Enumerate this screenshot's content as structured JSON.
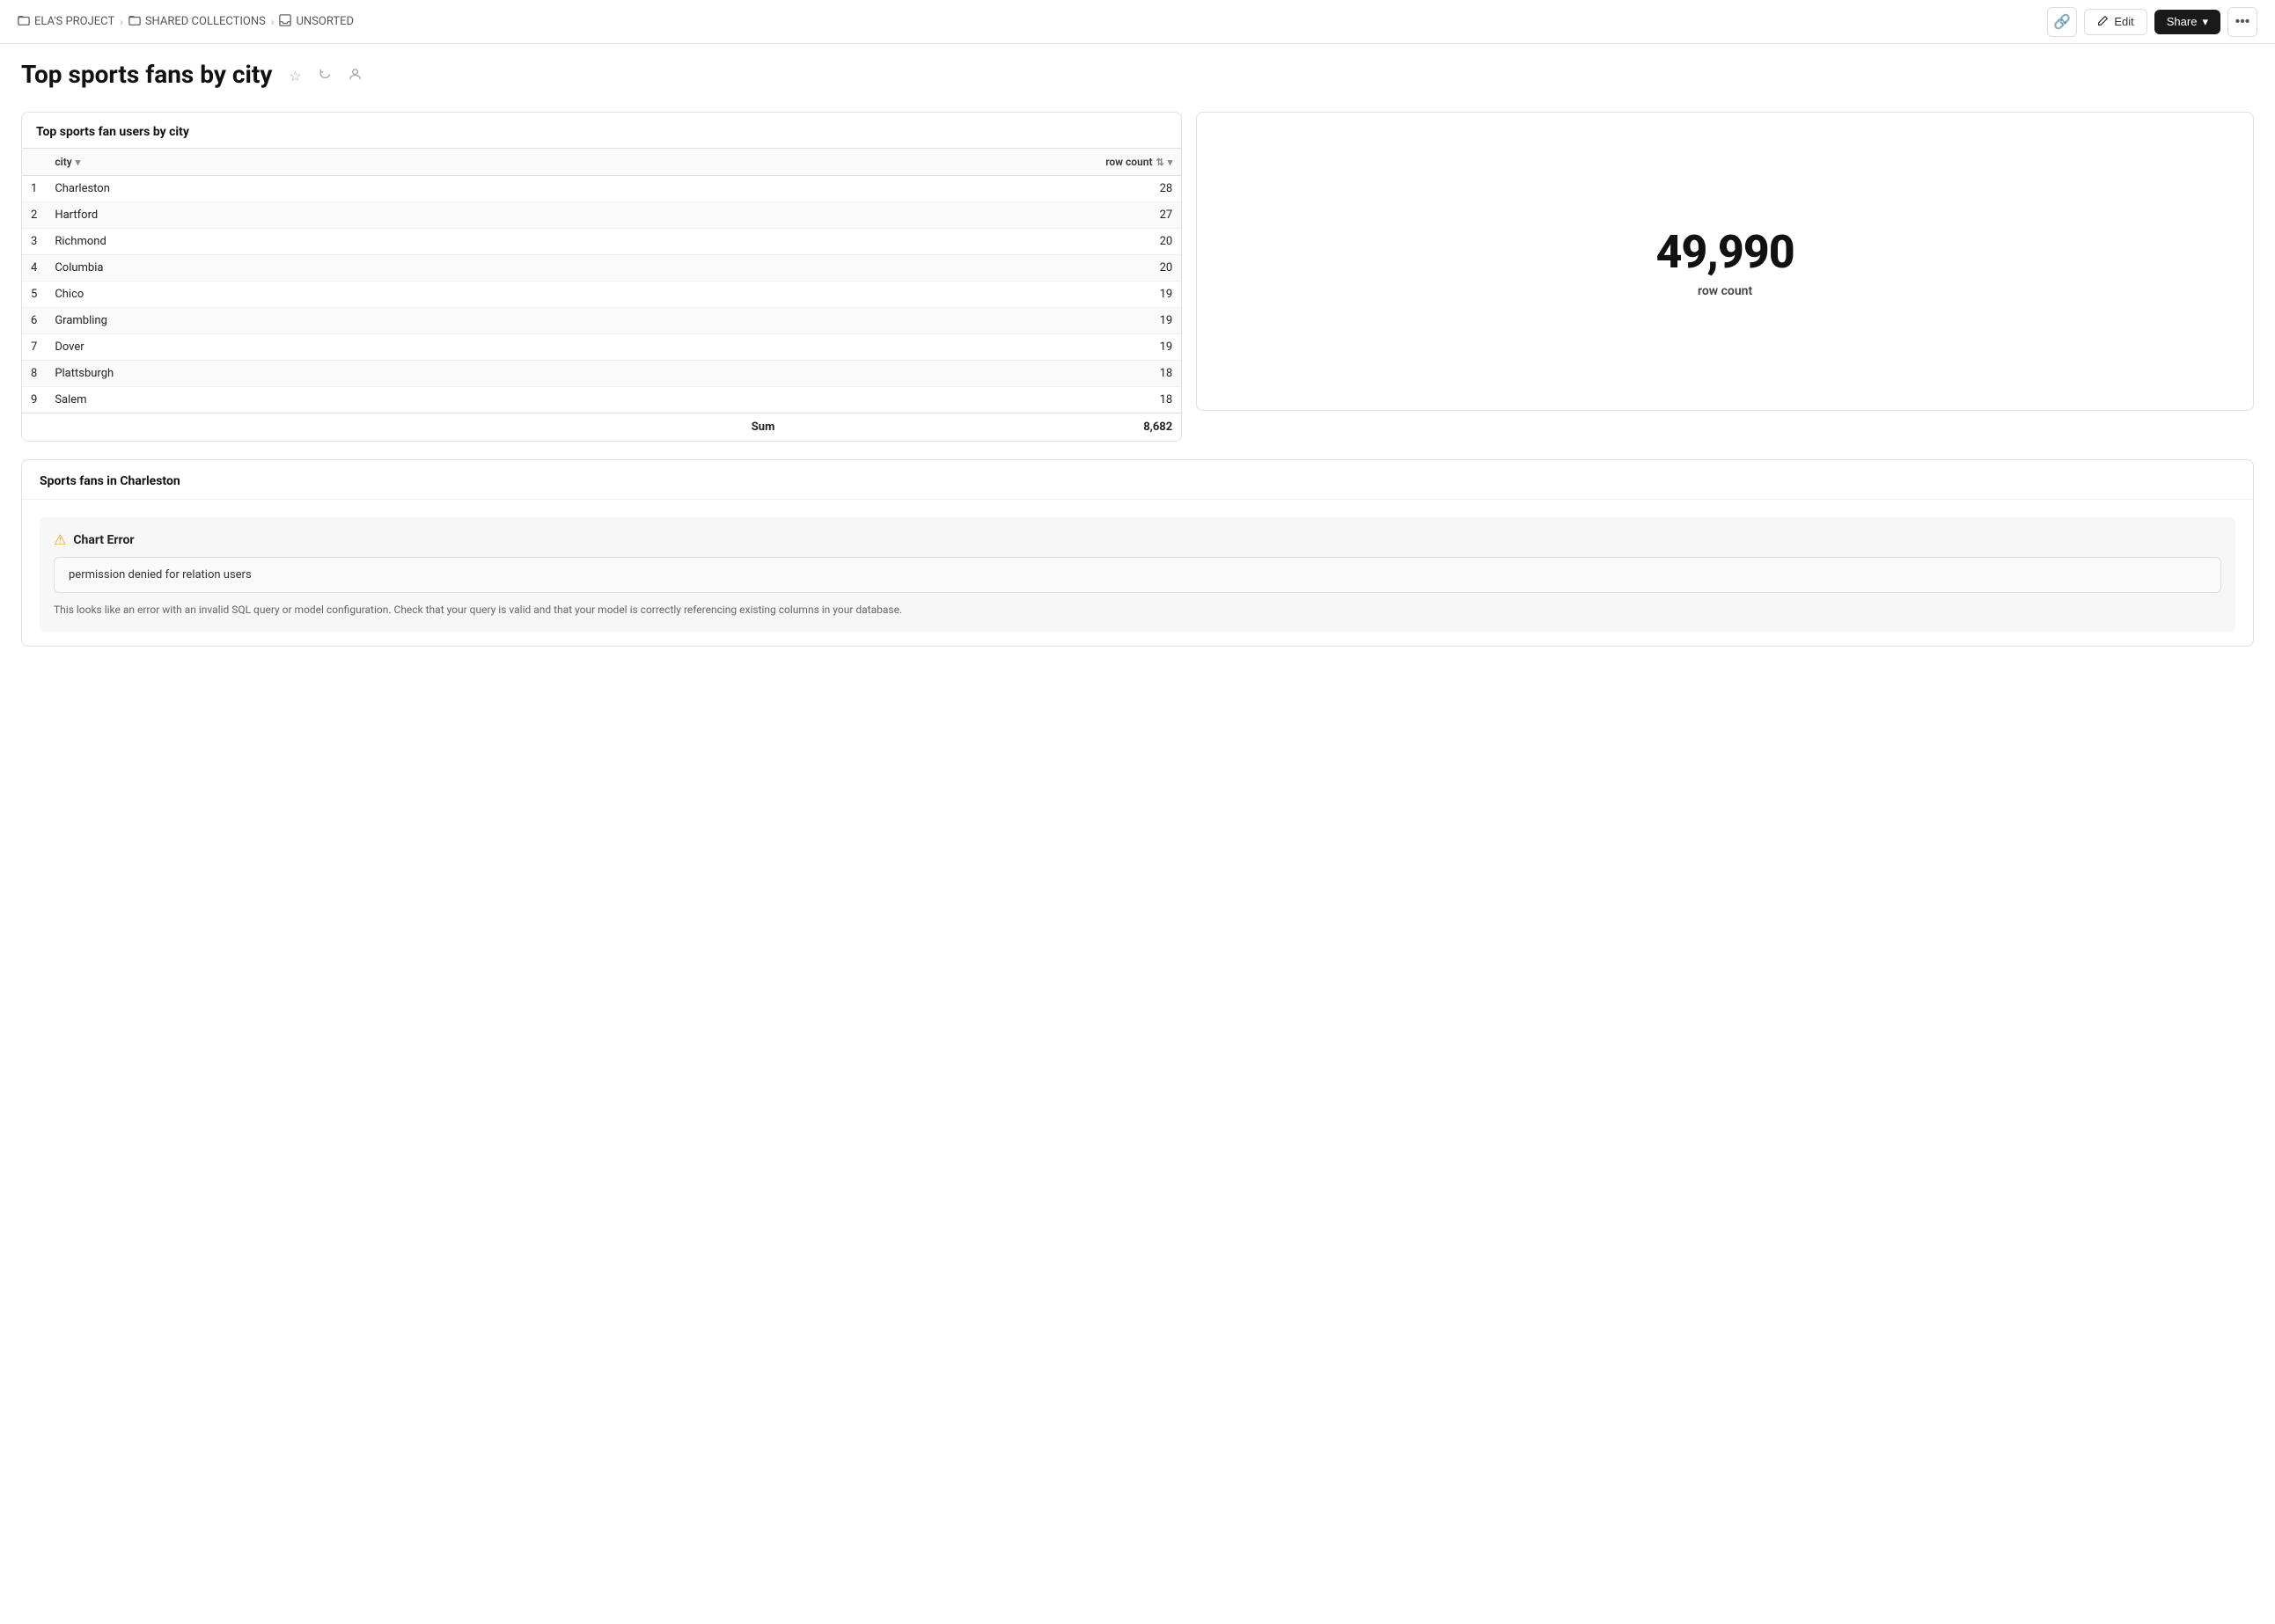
{
  "breadcrumb": {
    "items": [
      {
        "label": "ELA'S PROJECT",
        "icon": "folder-icon"
      },
      {
        "label": "SHARED COLLECTIONS",
        "icon": "folder-icon"
      },
      {
        "label": "UNSORTED",
        "icon": "inbox-icon"
      }
    ]
  },
  "nav": {
    "link_icon": "🔗",
    "edit_label": "Edit",
    "share_label": "Share",
    "more_icon": "⋯"
  },
  "page": {
    "title": "Top sports fans by city"
  },
  "table_card": {
    "title": "Top sports fan users by city",
    "columns": {
      "city": "city",
      "row_count": "row count"
    },
    "rows": [
      {
        "num": 1,
        "city": "Charleston",
        "count": 28
      },
      {
        "num": 2,
        "city": "Hartford",
        "count": 27
      },
      {
        "num": 3,
        "city": "Richmond",
        "count": 20
      },
      {
        "num": 4,
        "city": "Columbia",
        "count": 20
      },
      {
        "num": 5,
        "city": "Chico",
        "count": 19
      },
      {
        "num": 6,
        "city": "Grambling",
        "count": 19
      },
      {
        "num": 7,
        "city": "Dover",
        "count": 19
      },
      {
        "num": 8,
        "city": "Plattsburgh",
        "count": 18
      },
      {
        "num": 9,
        "city": "Salem",
        "count": 18
      }
    ],
    "footer": {
      "label": "Sum",
      "value": "8,682"
    }
  },
  "metric_card": {
    "value": "49,990",
    "label": "row count"
  },
  "charleston_card": {
    "title": "Sports fans in Charleston",
    "error_title": "Chart Error",
    "error_message": "permission denied for relation users",
    "error_hint": "This looks like an error with an invalid SQL query or model configuration. Check that your query is valid and that your model is correctly referencing existing columns in your database."
  }
}
